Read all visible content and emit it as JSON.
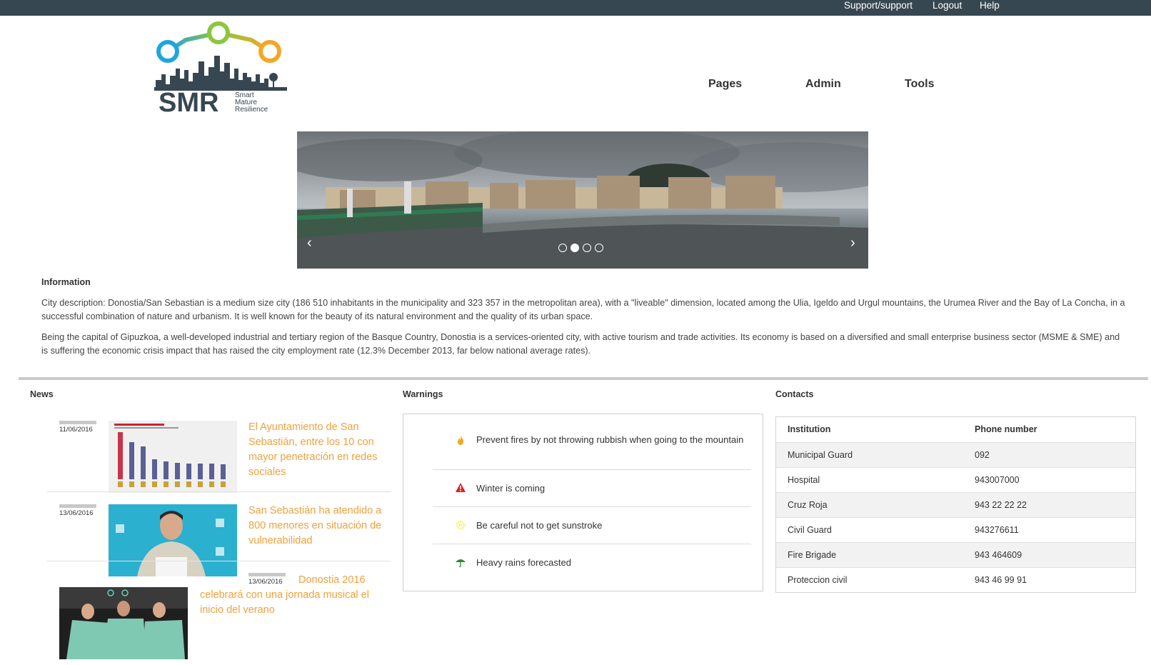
{
  "topbar": {
    "links": [
      "Support/support",
      "Logout",
      "Help"
    ]
  },
  "logo": {
    "abbr": "SMR",
    "tagline": [
      "Smart",
      "Mature",
      "Resilience"
    ]
  },
  "nav": {
    "items": [
      "Pages",
      "Admin",
      "Tools"
    ]
  },
  "carousel": {
    "prev": "‹",
    "next": "›",
    "slide_count": 4,
    "active_slide": 2
  },
  "information": {
    "title": "Information",
    "paragraphs": [
      "City description: Donostia/San Sebastian is a medium size city (186 510 inhabitants in the municipality and 323 357 in the metropolitan area), with a \"liveable\" dimension, located among the Ulia, Igeldo and Urgul mountains, the Urumea River and the Bay of La Concha, in a successful combination of nature and urbanism. It is well known for the beauty of its natural environment and the quality of its urban space.",
      "Being the capital of Gipuzkoa, a well-developed industrial and tertiary region of the Basque Country, Donostia is a services-oriented city, with active tourism and trade activities. Its economy is based on a diversified and small enterprise business sector (MSME & SME) and is suffering the economic crisis impact that has raised the city employment rate (12.3% December 2013, far below national average rates)."
    ]
  },
  "news": {
    "title": "News",
    "items": [
      {
        "date": "11/06/2016",
        "title": "El Ayuntamiento de San Sebastián, entre los 10 con mayor penetración en redes sociales"
      },
      {
        "date": "13/06/2016",
        "title": "San Sebastián ha atendido a 800 menores en situación de vulnerabilidad"
      },
      {
        "date": "13/06/2016",
        "title": "Donostia 2016 celebrará con una jornada musical el inicio del verano"
      }
    ]
  },
  "warnings": {
    "title": "Warnings",
    "items": [
      {
        "icon": "fire-icon",
        "color": "#f5a623",
        "text": "Prevent fires by not throwing rubbish when going to the mountain"
      },
      {
        "icon": "alert-triangle-icon",
        "color": "#e02020",
        "text": "Winter is coming"
      },
      {
        "icon": "sun-icon",
        "color": "#f8e71c",
        "text": "Be careful not to get sunstroke"
      },
      {
        "icon": "umbrella-icon",
        "color": "#2e8b2e",
        "text": "Heavy rains forecasted"
      }
    ]
  },
  "contacts": {
    "title": "Contacts",
    "headers": [
      "Institution",
      "Phone number"
    ],
    "rows": [
      [
        "Municipal Guard",
        "092"
      ],
      [
        "Hospital",
        "943007000"
      ],
      [
        "Cruz Roja",
        "943 22 22 22"
      ],
      [
        "Civil Guard",
        "943276611"
      ],
      [
        "Fire Brigade",
        "943 464609"
      ],
      [
        "Proteccion civil",
        "943 46 99 91"
      ]
    ]
  },
  "colors": {
    "topbar": "#374752",
    "accent_link": "#f0a13c",
    "logo_blue": "#1ea5e0",
    "logo_green": "#8cc63f",
    "logo_orange": "#f5a623",
    "logo_dark": "#374752"
  }
}
